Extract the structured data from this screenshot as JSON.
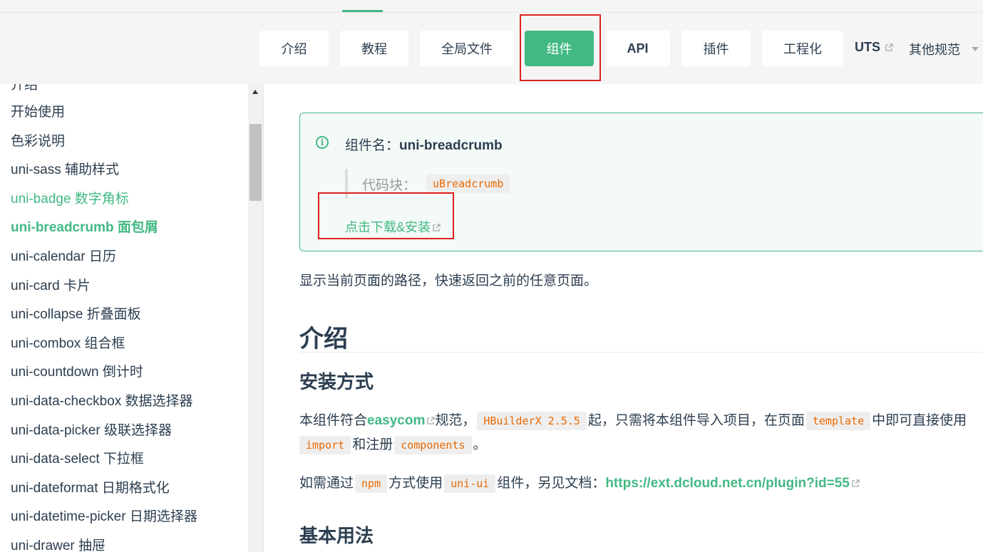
{
  "nav": {
    "tabs": [
      {
        "label": "介绍"
      },
      {
        "label": "教程"
      },
      {
        "label": "全局文件"
      },
      {
        "label": "组件"
      },
      {
        "label": "API"
      },
      {
        "label": "插件"
      },
      {
        "label": "工程化"
      }
    ],
    "uts_label": "UTS",
    "other_label": "其他规范"
  },
  "sidebar": {
    "items": [
      {
        "label": "介绍"
      },
      {
        "label": "开始使用"
      },
      {
        "label": "色彩说明"
      },
      {
        "label": "uni-sass 辅助样式"
      },
      {
        "label": "uni-badge 数字角标"
      },
      {
        "label": "uni-breadcrumb 面包屑"
      },
      {
        "label": "uni-calendar 日历"
      },
      {
        "label": "uni-card 卡片"
      },
      {
        "label": "uni-collapse 折叠面板"
      },
      {
        "label": "uni-combox 组合框"
      },
      {
        "label": "uni-countdown 倒计时"
      },
      {
        "label": "uni-data-checkbox 数据选择器"
      },
      {
        "label": "uni-data-picker 级联选择器"
      },
      {
        "label": "uni-data-select 下拉框"
      },
      {
        "label": "uni-dateformat 日期格式化"
      },
      {
        "label": "uni-datetime-picker 日期选择器"
      },
      {
        "label": "uni-drawer 抽屉"
      }
    ]
  },
  "infobox": {
    "title_prefix": "组件名：",
    "component_name": "uni-breadcrumb",
    "snippet_label": "代码块：",
    "snippet_code": "uBreadcrumb",
    "download_link": "点击下载&安装"
  },
  "content": {
    "description": "显示当前页面的路径，快速返回之前的任意页面。",
    "h_intro": "介绍",
    "h_install": "安装方式",
    "install_p1": {
      "t1": "本组件符合",
      "link": "easycom",
      "t2": "规范，",
      "code1": "HBuilderX 2.5.5",
      "t3": "起，只需将本组件导入项目，在页面",
      "code2": "template",
      "t4": "中即可直接使用"
    },
    "install_p2": {
      "code1": "import",
      "t1": "和注册",
      "code2": "components",
      "t2": "。"
    },
    "npm_p": {
      "t1": "如需通过",
      "code1": "npm",
      "t2": "方式使用",
      "code2": "uni-ui",
      "t3": "组件，另见文档：",
      "link": "https://ext.dcloud.net.cn/plugin?id=55"
    },
    "h_usage": "基本用法"
  },
  "colors": {
    "accent": "#42b983",
    "highlight_box": "#e02020",
    "code_text": "#e96900"
  }
}
